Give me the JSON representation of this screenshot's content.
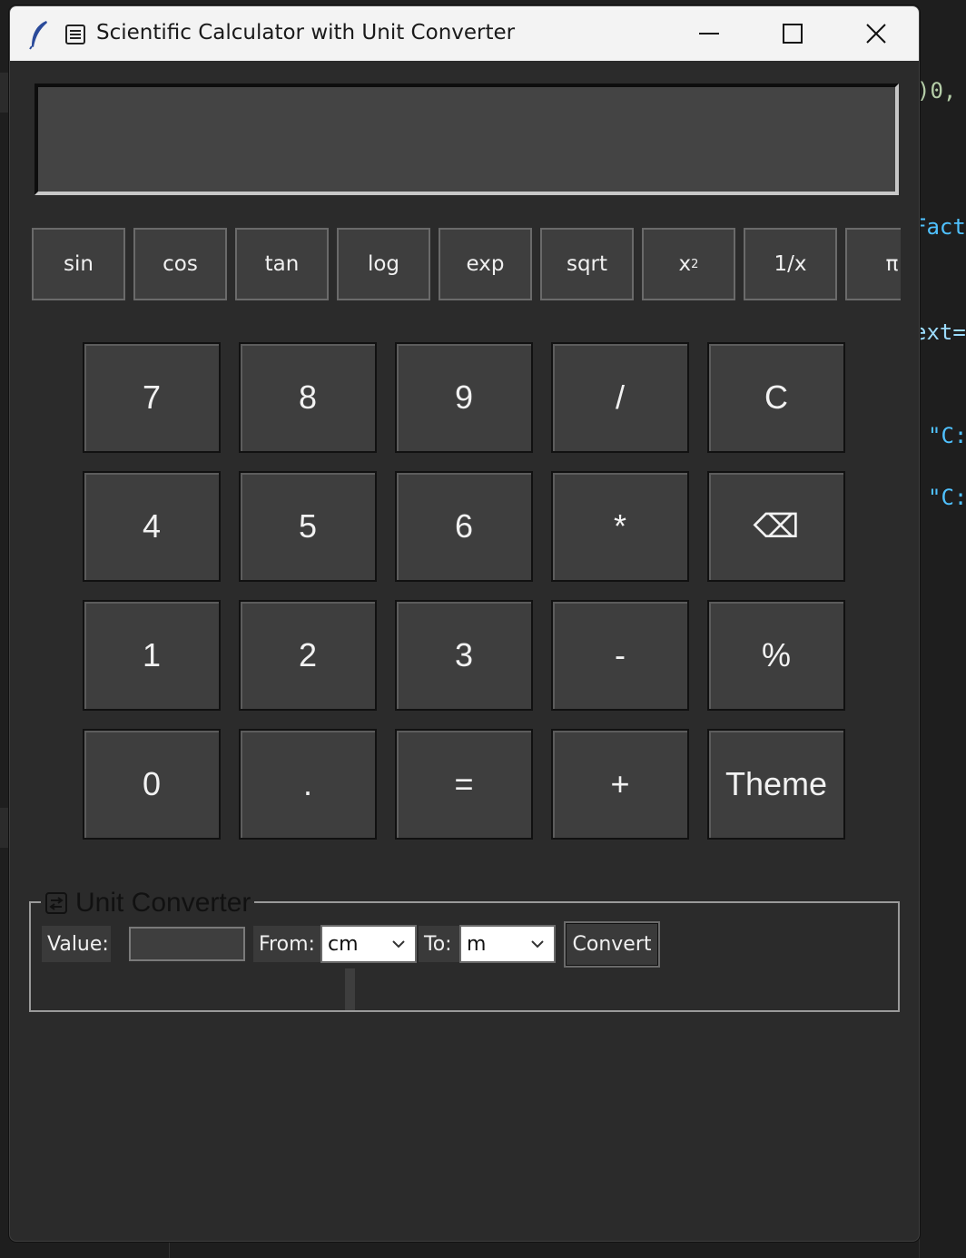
{
  "background_code": {
    "line1": ")0,",
    "line2": "Fact",
    "line3": "ext=",
    "line4": "\"C:",
    "line5": "\"C:"
  },
  "window": {
    "title": "Scientific Calculator with Unit Converter",
    "icons": {
      "app": "feather-icon",
      "window": "window-icon"
    },
    "controls": [
      "minimize-icon",
      "maximize-icon",
      "close-icon"
    ]
  },
  "display": {
    "value": ""
  },
  "scientific": {
    "sin": "sin",
    "cos": "cos",
    "tan": "tan",
    "log": "log",
    "exp": "exp",
    "sqrt": "sqrt",
    "x2_base": "x",
    "x2_exp": "2",
    "reciprocal": "1/x",
    "pi": "π"
  },
  "keypad": {
    "k7": "7",
    "k8": "8",
    "k9": "9",
    "div": "/",
    "clear": "C",
    "k4": "4",
    "k5": "5",
    "k6": "6",
    "mul": "*",
    "backspace": "⌫",
    "k1": "1",
    "k2": "2",
    "k3": "3",
    "sub": "-",
    "percent": "%",
    "k0": "0",
    "dot": ".",
    "equals": "=",
    "add": "+",
    "theme": "Theme"
  },
  "unit_converter": {
    "title": "Unit Converter",
    "value_label": "Value:",
    "value": "",
    "from_label": "From:",
    "from_unit": "cm",
    "to_label": "To:",
    "to_unit": "m",
    "convert_label": "Convert",
    "result": ""
  },
  "colors": {
    "window_bg": "#2b2b2b",
    "button_bg": "#3e3e3e",
    "display_bg": "#444444",
    "text": "#f0f0f0",
    "code_yellow": "#b5cea8",
    "code_blue": "#4fc1ff"
  }
}
